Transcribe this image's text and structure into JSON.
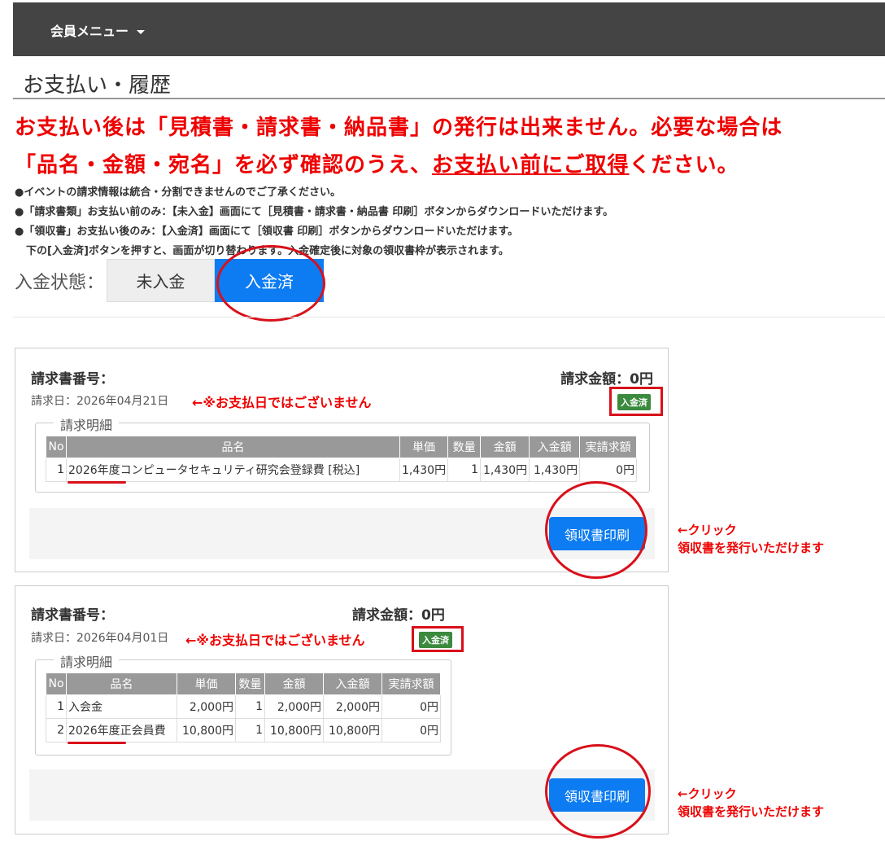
{
  "header": {
    "menu_label": "会員メニュー"
  },
  "page": {
    "title": "お支払い・履歴"
  },
  "warning": {
    "line1": "お支払い後は「見積書・請求書・納品書」の発行は出来ません。必要な場合は",
    "line2_before": "「品名・金額・宛名」を必ず確認のうえ、",
    "line2_underlined": "お支払い前にご取得",
    "line2_after": "ください。"
  },
  "notes": [
    "●イベントの請求情報は統合・分割できませんのでご了承ください。",
    "●「請求書類」お支払い前のみ：【未入金】画面にて［見積書・請求書・納品書 印刷］ボタンからダウンロードいただけます。",
    "●「領収書」お支払い後のみ：【入金済】画面にて［領収書 印刷］ボタンからダウンロードいただけます。",
    "下の[入金済]ボタンを押すと、画面が切り替わります。入金確定後に対象の領収書枠が表示されます。"
  ],
  "status": {
    "label": "入金状態：",
    "unpaid": "未入金",
    "paid": "入金済"
  },
  "colors": {
    "primary": "#0d7cf2",
    "danger": "#e00000",
    "badge": "#3b8a3e",
    "header": "#444444"
  },
  "invoices": [
    {
      "number_label": "請求書番号：",
      "amount_label": "請求金額：0円",
      "date": "請求日：2026年04月21日",
      "date_note": "←※お支払日ではございません",
      "badge": "入金済",
      "details_legend": "請求明細",
      "columns": [
        "No",
        "品名",
        "単価",
        "数量",
        "金額",
        "入金額",
        "実請求額"
      ],
      "rows": [
        [
          "1",
          "2026年度コンピュータセキュリティ研究会登録費 [税込]",
          "1,430円",
          "1",
          "1,430円",
          "1,430円",
          "0円"
        ]
      ],
      "print_button": "領収書印刷",
      "side_note1": "←クリック",
      "side_note2": "領収書を発行いただけます"
    },
    {
      "number_label": "請求書番号：",
      "amount_label": "請求金額：0円",
      "date": "請求日：2026年04月01日",
      "date_note": "←※お支払日ではございません",
      "badge": "入金済",
      "details_legend": "請求明細",
      "columns": [
        "No",
        "品名",
        "単価",
        "数量",
        "金額",
        "入金額",
        "実請求額"
      ],
      "rows": [
        [
          "1",
          "入会金",
          "2,000円",
          "1",
          "2,000円",
          "2,000円",
          "0円"
        ],
        [
          "2",
          "2026年度正会員費",
          "10,800円",
          "1",
          "10,800円",
          "10,800円",
          "0円"
        ]
      ],
      "print_button": "領収書印刷",
      "side_note1": "←クリック",
      "side_note2": "領収書を発行いただけます"
    }
  ]
}
